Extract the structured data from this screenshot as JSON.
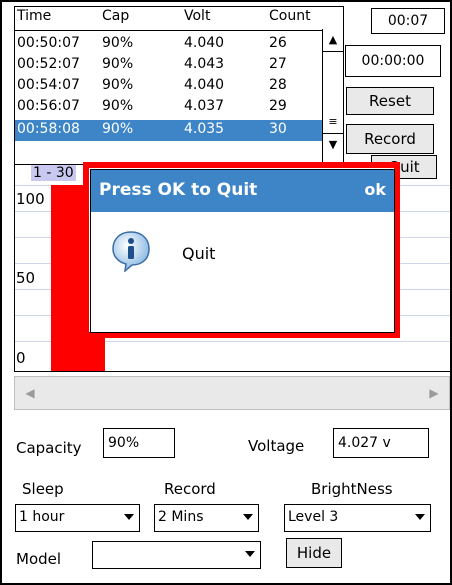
{
  "list": {
    "headers": {
      "time": "Time",
      "cap": "Cap",
      "volt": "Volt",
      "count": "Count"
    },
    "rows": [
      {
        "time": "00:50:07",
        "cap": "90%",
        "volt": "4.040",
        "count": "26"
      },
      {
        "time": "00:52:07",
        "cap": "90%",
        "volt": "4.043",
        "count": "27"
      },
      {
        "time": "00:54:07",
        "cap": "90%",
        "volt": "4.040",
        "count": "28"
      },
      {
        "time": "00:56:07",
        "cap": "90%",
        "volt": "4.037",
        "count": "29"
      },
      {
        "time": "00:58:08",
        "cap": "90%",
        "volt": "4.035",
        "count": "30"
      }
    ],
    "selected_row": 4
  },
  "controls": {
    "timer_elapsed": "00:07",
    "timer_total": "00:00:00",
    "reset_label": "Reset",
    "record_label": "Record",
    "quit_label": "Quit"
  },
  "chart": {
    "range_label": "1 - 30",
    "y_ticks": [
      "100",
      "50",
      "0"
    ]
  },
  "chart_data": {
    "type": "bar",
    "values": [
      100
    ],
    "ylim": [
      0,
      100
    ],
    "bar_color": "#ff0000"
  },
  "dialog": {
    "title": "Press OK to Quit",
    "ok_label": "ok",
    "message": "Quit",
    "icon": "info-icon"
  },
  "status": {
    "capacity_label": "Capacity",
    "capacity_value": "90%",
    "voltage_label": "Voltage",
    "voltage_value": "4.027 v"
  },
  "settings": {
    "sleep_label": "Sleep",
    "sleep_value": "1 hour",
    "record_label": "Record",
    "record_value": "2 Mins",
    "brightness_label": "BrightNess",
    "brightness_value": "Level 3",
    "model_label": "Model",
    "model_value": "",
    "hide_label": "Hide"
  },
  "colors": {
    "selection": "#3d85c6",
    "dialog_border": "#ff0000",
    "bar": "#ff0000"
  }
}
